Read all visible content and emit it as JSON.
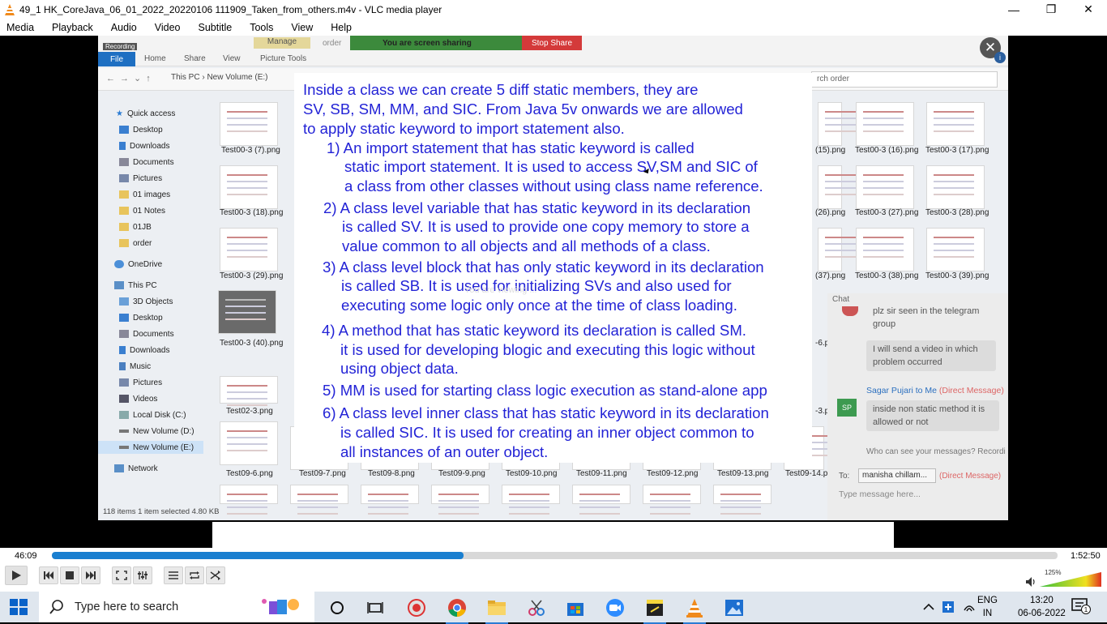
{
  "window": {
    "title": "49_1 HK_CoreJava_06_01_2022_20220106 111909_Taken_from_others.m4v - VLC media player",
    "minimize": "—",
    "restore": "❐",
    "close": "✕"
  },
  "menu": [
    "Media",
    "Playback",
    "Audio",
    "Video",
    "Subtitle",
    "Tools",
    "View",
    "Help"
  ],
  "video": {
    "explorer": {
      "recording_label": "Recording",
      "tabs": {
        "file": "File",
        "home": "Home",
        "share": "Share",
        "view": "View",
        "picture_tools": "Picture Tools",
        "manage": "Manage"
      },
      "window_title": "order",
      "address": "This PC  ›  New Volume (E:)",
      "search_placeholder": "rch order",
      "nav": [
        "Quick access",
        "Desktop",
        "Downloads",
        "Documents",
        "Pictures",
        "01 images",
        "01 Notes",
        "01JB",
        "order",
        "OneDrive",
        "This PC",
        "3D Objects",
        "Desktop",
        "Documents",
        "Downloads",
        "Music",
        "Pictures",
        "Videos",
        "Local Disk (C:)",
        "New Volume (D:)",
        "New Volume (E:)",
        "Network"
      ],
      "files_left": [
        "Test00-3 (7).png",
        "Test00-3 (18).png",
        "Test00-3 (29).png",
        "Test00-3 (40).png",
        "Test02-3.png",
        "Test09-6.png"
      ],
      "files_right_row1": [
        "(15).png",
        "Test00-3 (16).png",
        "Test00-3 (17).png"
      ],
      "files_right_row2": [
        "(26).png",
        "Test00-3 (27).png",
        "Test00-3 (28).png"
      ],
      "files_right_row3": [
        "(37).png",
        "Test00-3 (38).png",
        "Test00-3 (39).png"
      ],
      "files_right_misc": [
        "-6.p",
        "-3.p"
      ],
      "files_bottom": [
        "Test09-7.png",
        "Test09-8.png",
        "Test09-9.png",
        "Test09-10.png",
        "Test09-11.png",
        "Test09-12.png",
        "Test09-13.png",
        "Test09-14.p"
      ],
      "status": "118 items     1 item selected  4.80 KB"
    },
    "share": {
      "text": "You are screen sharing",
      "stop": "Stop Share"
    },
    "close_symbol": "✕",
    "info_symbol": "i",
    "chat": {
      "title": "Chat",
      "msg1": "plz sir seen in the telegram group",
      "msg2": "I will send a video in which problem occurred",
      "sender": "Sagar Pujari to Me",
      "sender_dm": "(Direct Message)",
      "avatar": "SP",
      "msg3": "inside non static method it is allowed or not",
      "who": "Who can see your messages? Recordi",
      "to_label": "To:",
      "to_value": "manisha chillam...",
      "to_dm": "(Direct Message)",
      "placeholder": "Type message here..."
    },
    "slide": {
      "lines": [
        "Inside a class we can create 5 diff static members, they are",
        "SV, SB, SM, MM, and SIC. From Java 5v onwards we are allowed",
        "to apply static keyword to import statement also.",
        "1) An import statement that has static keyword is called",
        "static import statement. It is used to access SV,SM and SIC of",
        "a class from other classes without using class name reference.",
        "2) A class level variable that has static keyword in its declaration",
        "is called SV. It is used to provide one copy memory to store a",
        "value common to all objects and all methods of a class.",
        "3) A class level block that has only static keyword in its declaration",
        "is called SB. It is used for initializing SVs and also used for",
        "executing some logic only once at the time of class loading.",
        "4) A method that has static keyword its declaration is called SM.",
        "it is used for developing blogic and executing this logic without",
        "using object data.",
        "5) MM is used for starting class logic execution as stand-alone app",
        "6) A class level inner class that has static keyword in its declaration",
        "is called SIC. It is used for creating an inner object common to",
        "all instances of an outer object."
      ],
      "watermark": "You are viewing ..."
    }
  },
  "player": {
    "elapsed": "46:09",
    "total": "1:52:50",
    "progress": 0.409,
    "volume": "125%"
  },
  "taskbar": {
    "search": "Type here to search",
    "lang1": "ENG",
    "lang2": "IN",
    "time": "13:20",
    "date": "06-06-2022",
    "notif": "1"
  }
}
